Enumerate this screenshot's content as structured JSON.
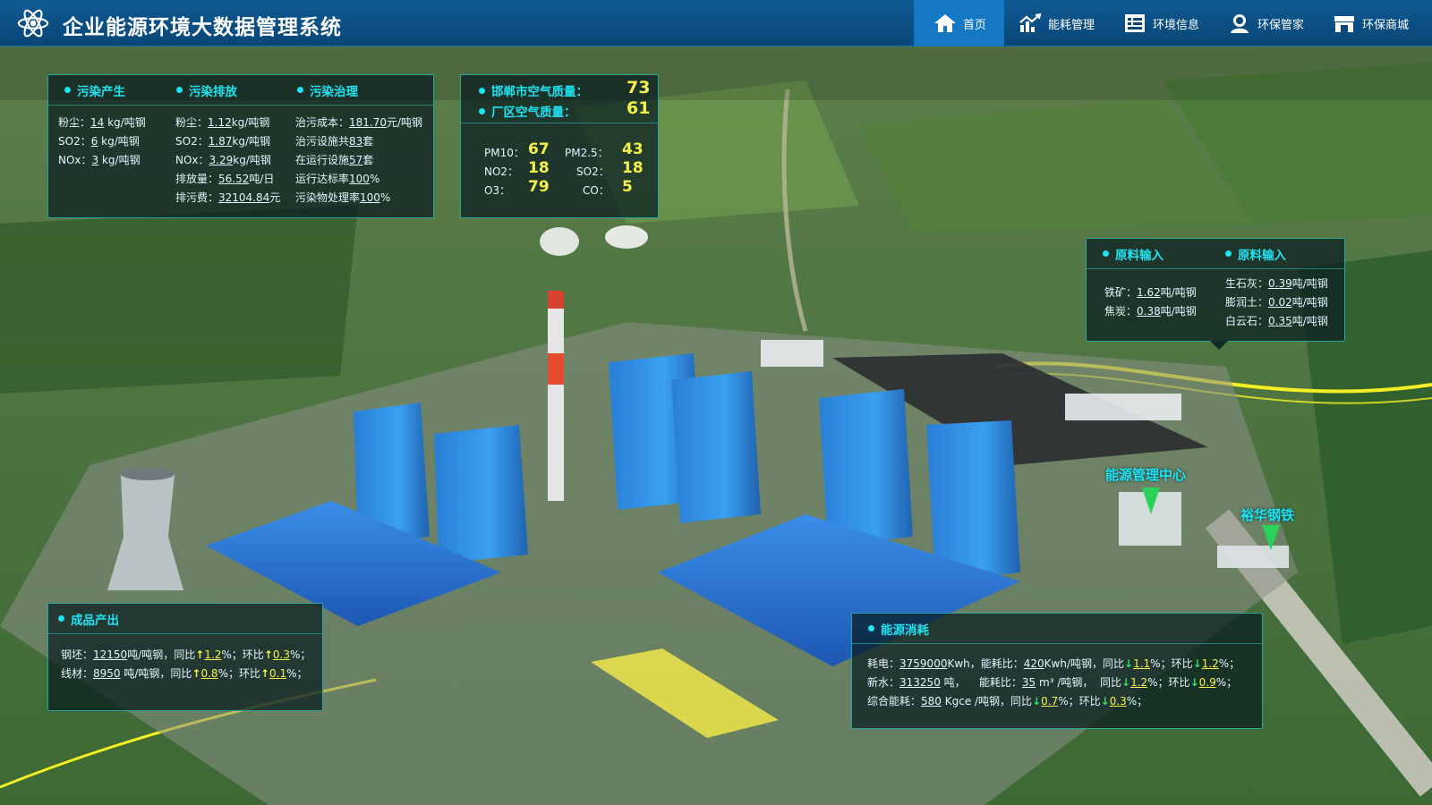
{
  "app": {
    "title": "企业能源环境大数据管理系统",
    "logo_icon": "atom-logo-icon"
  },
  "nav": [
    {
      "label": "首页",
      "icon": "home-icon",
      "active": true
    },
    {
      "label": "能耗管理",
      "icon": "energy-chart-icon",
      "active": false
    },
    {
      "label": "环境信息",
      "icon": "info-card-icon",
      "active": false
    },
    {
      "label": "环保管家",
      "icon": "butler-user-icon",
      "active": false
    },
    {
      "label": "环保商城",
      "icon": "shop-icon",
      "active": false
    }
  ],
  "pollution": {
    "produce_title": "污染产生",
    "emit_title": "污染排放",
    "treat_title": "污染治理",
    "produce": [
      {
        "label": "粉尘：",
        "value": "14",
        "unit": " kg/吨钢"
      },
      {
        "label": "SO2：",
        "value": "6",
        "unit": " kg/吨钢"
      },
      {
        "label": "NOx：",
        "value": "3",
        "unit": " kg/吨钢"
      }
    ],
    "emit": [
      {
        "label": "粉尘：",
        "value": "1.12",
        "unit": "kg/吨钢"
      },
      {
        "label": "SO2：",
        "value": "1.87",
        "unit": "kg/吨钢"
      },
      {
        "label": "NOx：",
        "value": "3.29",
        "unit": "kg/吨钢"
      },
      {
        "label": "排放量：",
        "value": "56.52",
        "unit": "吨/日"
      },
      {
        "label": "排污费：",
        "value": "32104.84",
        "unit": "元"
      }
    ],
    "treat": [
      {
        "label": "治污成本：",
        "value": "181.70",
        "unit": "元/吨钢"
      },
      {
        "label": "治污设施共",
        "value": "83",
        "unit": "套"
      },
      {
        "label": "在运行设施",
        "value": "57",
        "unit": "套"
      },
      {
        "label": "运行达标率",
        "value": "100",
        "unit": "%"
      },
      {
        "label": "污染物处理率",
        "value": "100",
        "unit": "%"
      }
    ]
  },
  "air": {
    "city_label": "邯郸市空气质量：",
    "city_value": "73",
    "plant_label": "厂区空气质量：",
    "plant_value": "61",
    "metrics": [
      {
        "label": "PM10：",
        "value": "67"
      },
      {
        "label": "PM2.5：",
        "value": "43"
      },
      {
        "label": "NO2：",
        "value": "18"
      },
      {
        "label": "SO2：",
        "value": "18"
      },
      {
        "label": "O3：",
        "value": "79"
      },
      {
        "label": "CO：",
        "value": "5"
      }
    ]
  },
  "raw": {
    "title_left": "原料输入",
    "title_right": "原料输入",
    "left": [
      {
        "label": "铁矿：",
        "value": "1.62",
        "unit": "吨/吨钢"
      },
      {
        "label": "焦炭：",
        "value": "0.38",
        "unit": "吨/吨钢"
      }
    ],
    "right": [
      {
        "label": "生石灰：",
        "value": "0.39",
        "unit": "吨/吨钢"
      },
      {
        "label": "膨润土：",
        "value": "0.02",
        "unit": "吨/吨钢"
      },
      {
        "label": "白云石：",
        "value": "0.35",
        "unit": "吨/吨钢"
      }
    ]
  },
  "product": {
    "title": "成品产出",
    "rows": [
      {
        "label": "钢坯：",
        "value": "12150",
        "unit": "吨/吨钢，同比",
        "yoy": "1.2",
        "mid": "%；环比",
        "mom": "0.3",
        "end": "%；"
      },
      {
        "label": "线材：",
        "value": "8950",
        "unit": " 吨/吨钢，同比",
        "yoy": "0.8",
        "mid": "%；环比",
        "mom": "0.1",
        "end": "%；"
      }
    ]
  },
  "energy": {
    "title": "能源消耗",
    "rows": [
      {
        "label": "耗电：",
        "value": "3759000",
        "unit": "Kwh，能耗比：",
        "ratio": "420",
        "ratio_unit": "Kwh/吨钢，同比",
        "yoy": "1.1",
        "mid": "%；环比",
        "mom": "1.2",
        "end": "%；"
      },
      {
        "label": "新水：",
        "value": "313250",
        "unit": " 吨，    能耗比：",
        "ratio": "35",
        "ratio_unit": " m³ /吨钢，  同比",
        "yoy": "1.2",
        "mid": "%；环比",
        "mom": "0.9",
        "end": "%；"
      },
      {
        "label": "综合能耗：",
        "value": "580",
        "unit": " Kgce /吨钢，同比",
        "yoy": "0.7",
        "mid": "%；环比",
        "mom": "0.3",
        "end": "%；"
      }
    ]
  },
  "map_labels": {
    "energy_center": "能源管理中心",
    "company": "裕华钢铁"
  },
  "arrows": {
    "up": "↑",
    "down": "↓"
  },
  "colors": {
    "header_bg": "#0a4676",
    "nav_active": "#1478c2",
    "accent_cyan": "#1fe3f1",
    "value_yellow": "#f5f24b",
    "panel_border": "#2aa59a",
    "arrow_down": "#2ee36b"
  }
}
